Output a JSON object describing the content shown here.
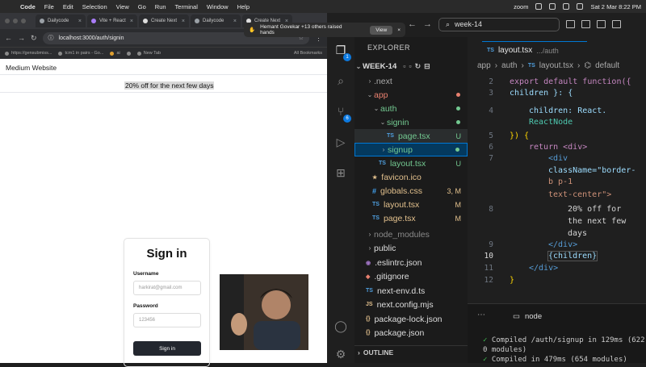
{
  "menubar": {
    "app": "Code",
    "items": [
      "File",
      "Edit",
      "Selection",
      "View",
      "Go",
      "Run",
      "Terminal",
      "Window",
      "Help"
    ],
    "zoom": "zoom",
    "clock": "Sat 2 Mar  8:22 PM"
  },
  "browser": {
    "tabs": [
      "Dailycode",
      "Vite + React",
      "Create Next",
      "Dailycode",
      "Create Next"
    ],
    "url": "localhost:3000/auth/signin",
    "bookmarks": [
      "https://gensubmiss...",
      "tcm1 in pairs - Go...",
      "ai",
      "",
      "New Tab"
    ],
    "all_bookmarks": "All Bookmarks",
    "site_title": "Medium Website",
    "banner": "20% off for the next few days",
    "signin": {
      "heading": "Sign in",
      "username_label": "Username",
      "username_placeholder": "harkirat@gmail.com",
      "password_label": "Password",
      "password_placeholder": "123456",
      "button": "Sign in"
    }
  },
  "notification": {
    "text": "Hemant Govekar +13 others raised hands",
    "view": "View",
    "close": "×"
  },
  "vscode": {
    "search": "week-14",
    "explorer_title": "EXPLORER",
    "root": "WEEK-14",
    "tree": [
      {
        "name": ".next",
        "status": ""
      },
      {
        "name": "app",
        "status": ""
      },
      {
        "name": "auth",
        "status": ""
      },
      {
        "name": "signin",
        "status": ""
      },
      {
        "name": "page.tsx",
        "status": "U"
      },
      {
        "name": "signup",
        "status": ""
      },
      {
        "name": "layout.tsx",
        "status": "U"
      },
      {
        "name": "favicon.ico",
        "status": ""
      },
      {
        "name": "globals.css",
        "status": "3, M"
      },
      {
        "name": "layout.tsx",
        "status": "M"
      },
      {
        "name": "page.tsx",
        "status": "M"
      },
      {
        "name": "node_modules",
        "status": ""
      },
      {
        "name": "public",
        "status": ""
      },
      {
        "name": ".eslintrc.json",
        "status": ""
      },
      {
        "name": ".gitignore",
        "status": ""
      },
      {
        "name": "next-env.d.ts",
        "status": ""
      },
      {
        "name": "next.config.mjs",
        "status": ""
      },
      {
        "name": "package-lock.json",
        "status": ""
      },
      {
        "name": "package.json",
        "status": ""
      }
    ],
    "outline": "OUTLINE",
    "badges": {
      "explorer": "1",
      "scm": "6"
    },
    "editor_tab": {
      "icon": "TS",
      "name": "layout.tsx",
      "path": ".../auth"
    },
    "breadcrumb": [
      "app",
      "auth",
      "layout.tsx",
      "default"
    ],
    "line_numbers": [
      "2",
      "3",
      "4",
      "5",
      "6",
      "7",
      "",
      "",
      "8",
      "",
      "",
      "9",
      "10",
      "11",
      "12"
    ],
    "code": {
      "l2": "export default function({",
      "l3": "children }: {",
      "l4a": "children: React.",
      "l4b": "ReactNode",
      "l5": "}) {",
      "l6": "return <div>",
      "l7a": "<div",
      "l7b": "className=\"border-",
      "l7c": "b p-1",
      "l7d": "text-center\">",
      "l8a": "20% off for",
      "l8b": "the next few",
      "l8c": "days",
      "l9": "</div>",
      "l10": "{children}",
      "l11": "</div>",
      "l12": "}"
    },
    "terminal": {
      "tab": "node",
      "line1": "Compiled /auth/signup in 129ms (622",
      "line2": "0 modules)",
      "line3": "Compiled in 479ms (654 modules)",
      "check": "✓"
    }
  },
  "colors": {
    "accent": "#0078d4",
    "keyword": "#c586c0",
    "tag": "#569cd6",
    "attr": "#9cdcfe",
    "string": "#ce9178",
    "untracked": "#73c991",
    "modified": "#e2c08d",
    "type": "#4ec9b0"
  }
}
